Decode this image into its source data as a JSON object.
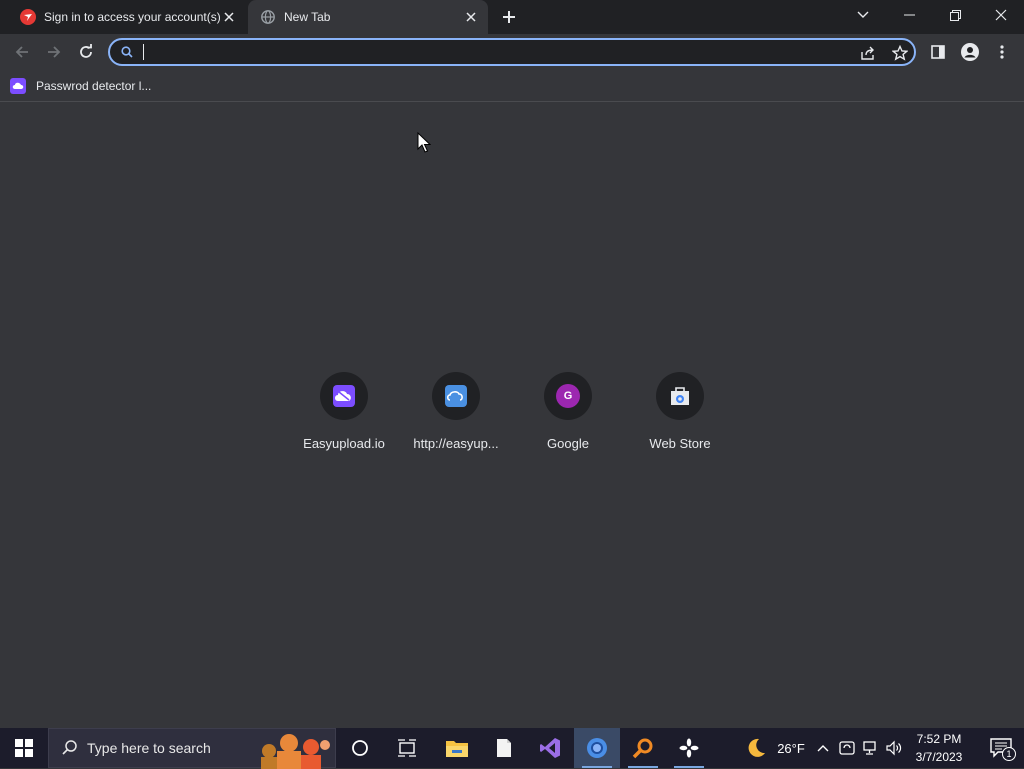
{
  "tabs": [
    {
      "title": "Sign in to access your account(s)",
      "favicon": "red-brand-icon",
      "active": false
    },
    {
      "title": "New Tab",
      "favicon": "globe-icon",
      "active": true
    }
  ],
  "omnibox": {
    "value": "",
    "placeholder": ""
  },
  "bookmarks": [
    {
      "label": "Passwrod detector l...",
      "icon": "purple-app-icon"
    }
  ],
  "shortcuts": [
    {
      "label": "Easyupload.io",
      "icon": "easyupload-icon"
    },
    {
      "label": "http://easyup...",
      "icon": "cloud-icon"
    },
    {
      "label": "Google",
      "icon": "google-g-icon",
      "letter": "G"
    },
    {
      "label": "Web Store",
      "icon": "web-store-icon"
    }
  ],
  "taskbar": {
    "search_placeholder": "Type here to search",
    "weather": "26°F",
    "time": "7:52 PM",
    "date": "3/7/2023",
    "notification_count": "1"
  },
  "colors": {
    "page_bg": "#35363a",
    "tabstrip_bg": "#202124",
    "accent": "#8ab4f8",
    "text": "#e8eaed"
  }
}
